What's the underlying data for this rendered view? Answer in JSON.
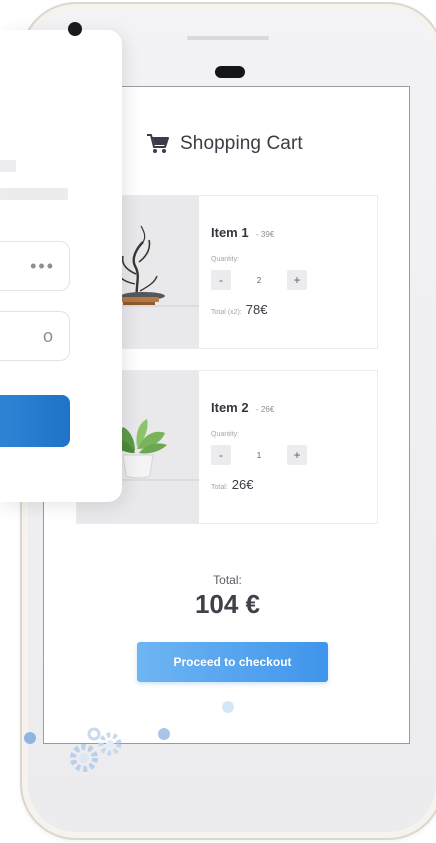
{
  "cart": {
    "title": "Shopping Cart",
    "cart_icon": "shopping-cart-icon",
    "items": [
      {
        "name": "Item 1",
        "price": "- 39€",
        "quantity_label": "Quantity:",
        "quantity": "2",
        "total_label": "Total (x2):",
        "total": "78€",
        "image": "bonsai-tree-image"
      },
      {
        "name": "Item 2",
        "price": "- 26€",
        "quantity_label": "Quantity:",
        "quantity": "1",
        "total_label": "Total:",
        "total": "26€",
        "image": "potted-plant-image"
      }
    ],
    "decrement_label": "-",
    "increment_label": "+",
    "grand_total_label": "Total:",
    "grand_total": "104 €",
    "checkout_label": "Proceed to checkout"
  },
  "login": {
    "password_value": "•••",
    "second_value": "o"
  },
  "colors": {
    "accent": "#3f95ec",
    "login_button": "#1f73c8",
    "text_dark": "#3a3d45"
  }
}
